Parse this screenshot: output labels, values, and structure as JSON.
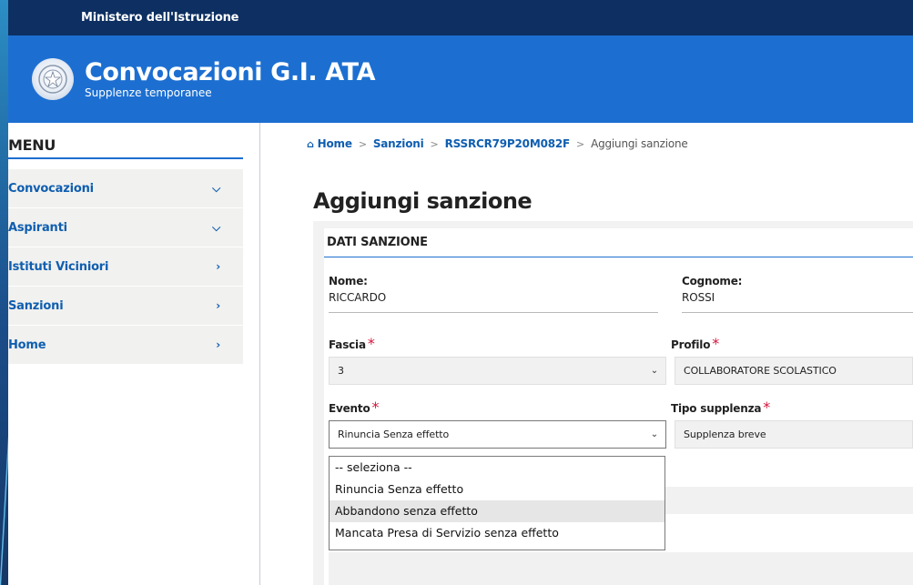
{
  "topbar": {
    "ministry": "Ministero dell'Istruzione"
  },
  "header": {
    "title": "Convocazioni G.I. ATA",
    "subtitle": "Supplenze temporanee",
    "emblem_icon": "republic-emblem-icon"
  },
  "sidebar": {
    "title": "MENU",
    "items": [
      {
        "label": "Convocazioni",
        "icon": "chevron-down-icon"
      },
      {
        "label": "Aspiranti",
        "icon": "chevron-down-icon"
      },
      {
        "label": "Istituti Viciniori",
        "icon": "chevron-right-icon"
      },
      {
        "label": "Sanzioni",
        "icon": "chevron-right-icon"
      },
      {
        "label": "Home",
        "icon": "chevron-right-icon"
      }
    ]
  },
  "breadcrumb": {
    "home": "Home",
    "sanzioni": "Sanzioni",
    "code": "RSSRCR79P20M082F",
    "current": "Aggiungi sanzione"
  },
  "page": {
    "title": "Aggiungi sanzione",
    "section_title": "DATI SANZIONE"
  },
  "form": {
    "nome_label": "Nome:",
    "nome_value": "RICCARDO",
    "cognome_label": "Cognome:",
    "cognome_value": "ROSSI",
    "fascia_label": "Fascia",
    "fascia_value": "3",
    "profilo_label": "Profilo",
    "profilo_value": "COLLABORATORE SCOLASTICO",
    "evento_label": "Evento",
    "evento_value": "Rinuncia Senza effetto",
    "tipo_label": "Tipo supplenza",
    "tipo_value": "Supplenza breve",
    "required_mark": "*"
  },
  "evento_options": [
    "-- seleziona --",
    "Rinuncia Senza effetto",
    "Abbandono senza effetto",
    "Mancata Presa di Servizio senza effetto"
  ],
  "colors": {
    "topbar": "#0d2f61",
    "header": "#1c6fd1",
    "link": "#0f5eb0",
    "required": "#d4143c"
  }
}
